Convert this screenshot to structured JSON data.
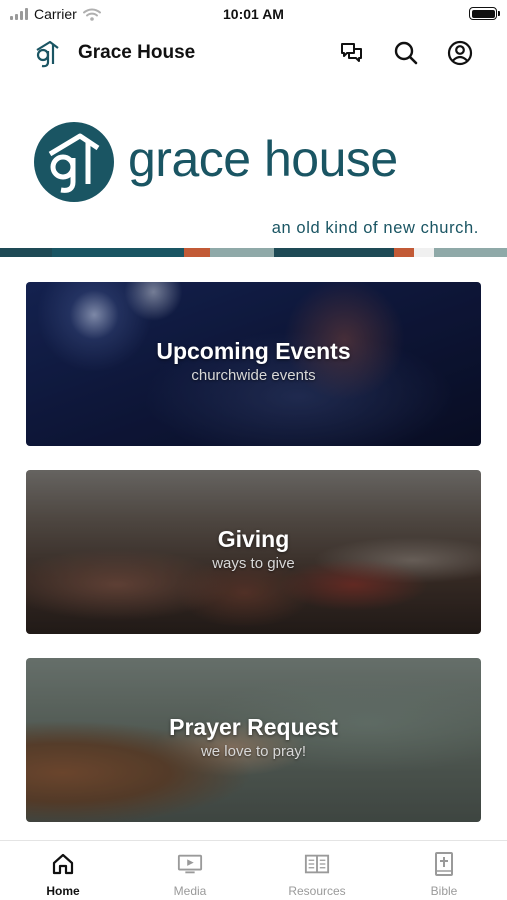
{
  "status_bar": {
    "carrier": "Carrier",
    "time": "10:01 AM"
  },
  "header": {
    "title": "Grace House",
    "icons": [
      "chat-icon",
      "search-icon",
      "profile-icon"
    ]
  },
  "brand": {
    "logo_mark": "gh",
    "name": "grace house",
    "tagline": "an old kind of new church.",
    "colors": {
      "primary": "#1a5563",
      "accent": "#c25a36",
      "light": "#8fa9a8"
    }
  },
  "cards": [
    {
      "title": "Upcoming Events",
      "subtitle": "churchwide events"
    },
    {
      "title": "Giving",
      "subtitle": "ways to give"
    },
    {
      "title": "Prayer Request",
      "subtitle": "we love to pray!"
    }
  ],
  "tabs": [
    {
      "label": "Home",
      "icon": "home-icon",
      "active": true
    },
    {
      "label": "Media",
      "icon": "media-icon",
      "active": false
    },
    {
      "label": "Resources",
      "icon": "book-icon",
      "active": false
    },
    {
      "label": "Bible",
      "icon": "bible-icon",
      "active": false
    }
  ]
}
